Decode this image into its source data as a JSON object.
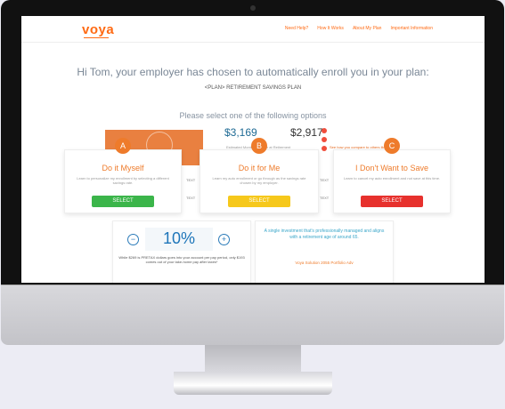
{
  "header": {
    "logo": "voya",
    "nav": [
      "Need Help?",
      "How It Works",
      "About My Plan",
      "Important Information"
    ]
  },
  "greeting": "Hi Tom, your employer has chosen to automatically enroll you in your plan:",
  "plan_name": "<PLAN> RETIREMENT SAVINGS PLAN",
  "instruction": "Please select one of the following options",
  "background": {
    "amount1": "$3,169",
    "amount2": "$2,917",
    "muted_text": "Estimated Monthly Income at Retirement",
    "link_text": "See how you compare to others like you",
    "side_labels": [
      "TEXT",
      "TEXT",
      "TEXT",
      "TEXT"
    ]
  },
  "options": [
    {
      "badge": "A",
      "title": "Do it Myself",
      "description": "Learn to personalize my enrollment by selecting a different savings rate.",
      "button": "SELECT",
      "button_color": "#3bb54a"
    },
    {
      "badge": "B",
      "title": "Do it for Me",
      "description": "Learn my auto enrollment or go through as the savings rate chosen by my employer.",
      "button": "SELECT",
      "button_color": "#f6c81b"
    },
    {
      "badge": "C",
      "title": "I Don't Want to Save",
      "description": "Learn to cancel my auto enrollment and not save at this time.",
      "button": "SELECT",
      "button_color": "#e7312d"
    }
  ],
  "savings": {
    "rate": "10%",
    "minus": "−",
    "plus": "+",
    "note": "While $269 is PRETAX dollars goes into your account per pay period, only $193 comes out of your take-home pay after taxes*"
  },
  "investment": {
    "description": "A single investment that's professionally managed and aligns with a retirement age of around 65.",
    "fund": "Voya Solution 2055 Portfolio Adv"
  },
  "colors": {
    "accent": "#ee7b2b",
    "primary_blue": "#1d75b9",
    "green": "#3bb54a",
    "yellow": "#f6c81b",
    "red": "#e7312d"
  }
}
